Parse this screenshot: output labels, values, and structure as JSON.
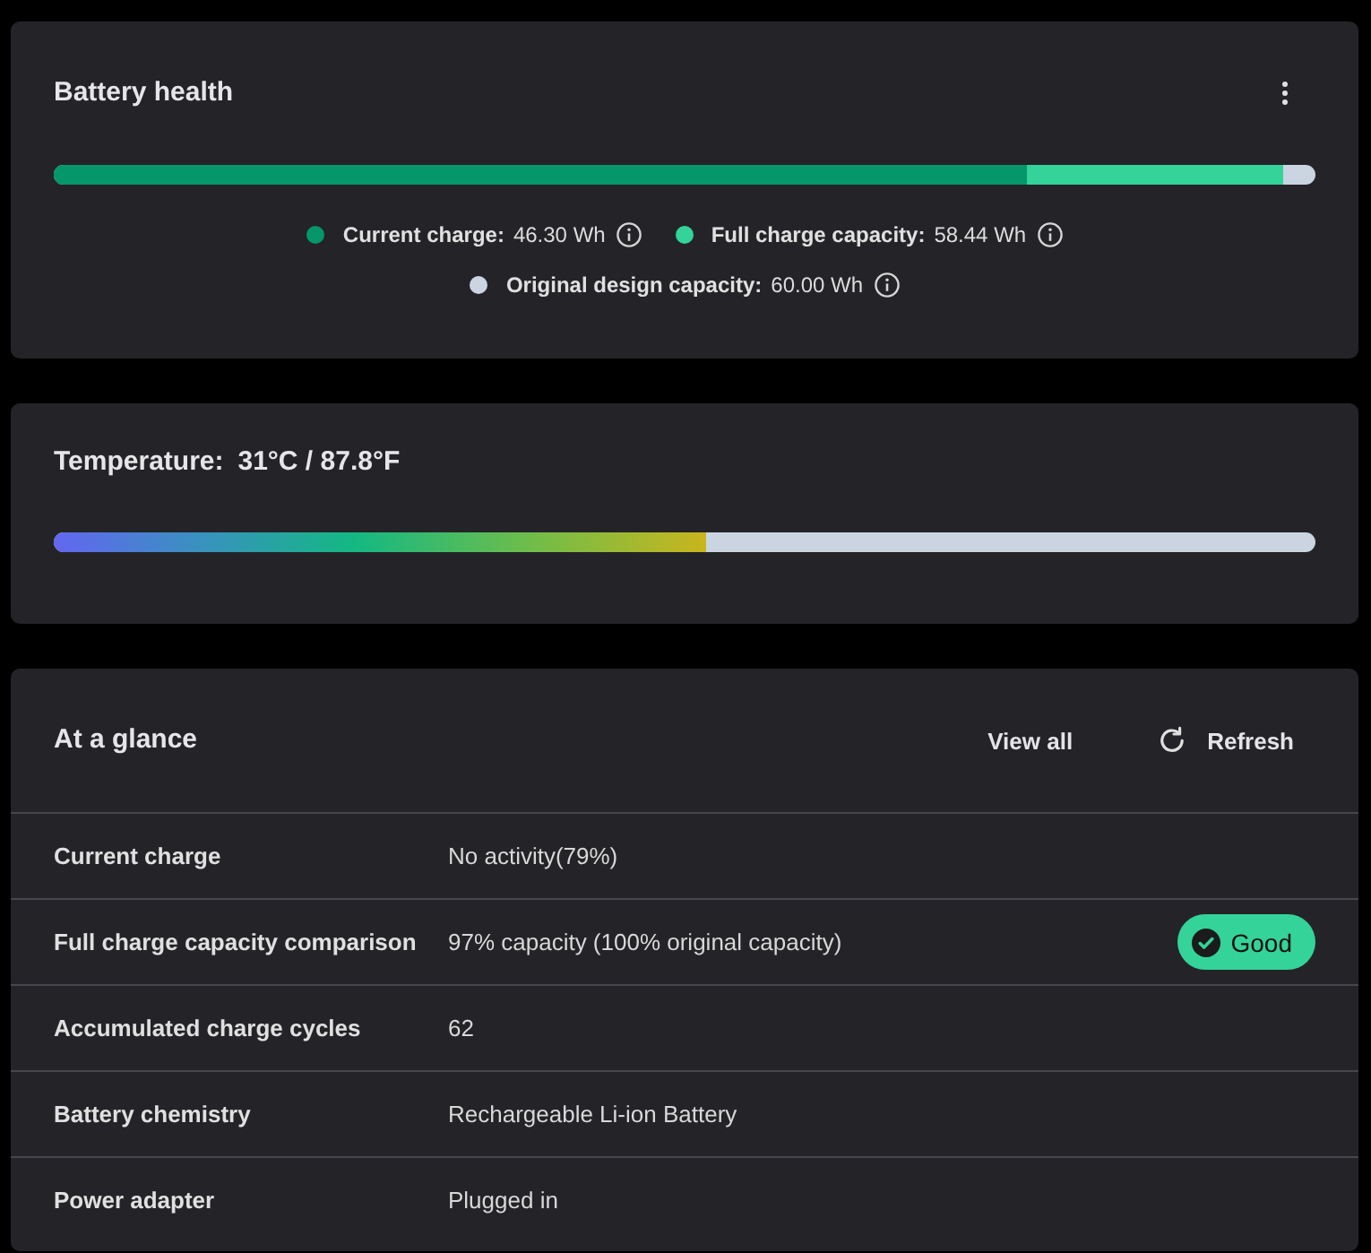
{
  "battery_health": {
    "title": "Battery health",
    "legend": [
      {
        "label": "Current charge:",
        "value": "46.30 Wh",
        "color": "#059669",
        "level": 0.772
      },
      {
        "label": "Full charge capacity:",
        "value": "58.44 Wh",
        "color": "#34d399",
        "level": 0.974
      },
      {
        "label": "Original design capacity:",
        "value": "60.00 Wh",
        "color": "#cbd5e1",
        "level": 1
      }
    ]
  },
  "temperature": {
    "label": "Temperature:",
    "value": "31°C / 87.8°F",
    "level": 0.517
  },
  "at_a_glance": {
    "title": "At a glance",
    "actions": [
      {
        "kind": "link",
        "label": "View all"
      },
      {
        "kind": "refresh",
        "label": "Refresh"
      }
    ],
    "rows": [
      {
        "label": "Current charge",
        "value": "No activity(79%)"
      },
      {
        "label": "Full charge capacity comparison",
        "value": "97% capacity (100% original capacity)",
        "badge": {
          "label": "Good",
          "color": "#34d399"
        }
      },
      {
        "label": "Accumulated charge cycles",
        "value": "62"
      },
      {
        "label": "Battery chemistry",
        "value": "Rechargeable Li-ion Battery"
      },
      {
        "label": "Power adapter",
        "value": "Plugged in"
      }
    ]
  }
}
